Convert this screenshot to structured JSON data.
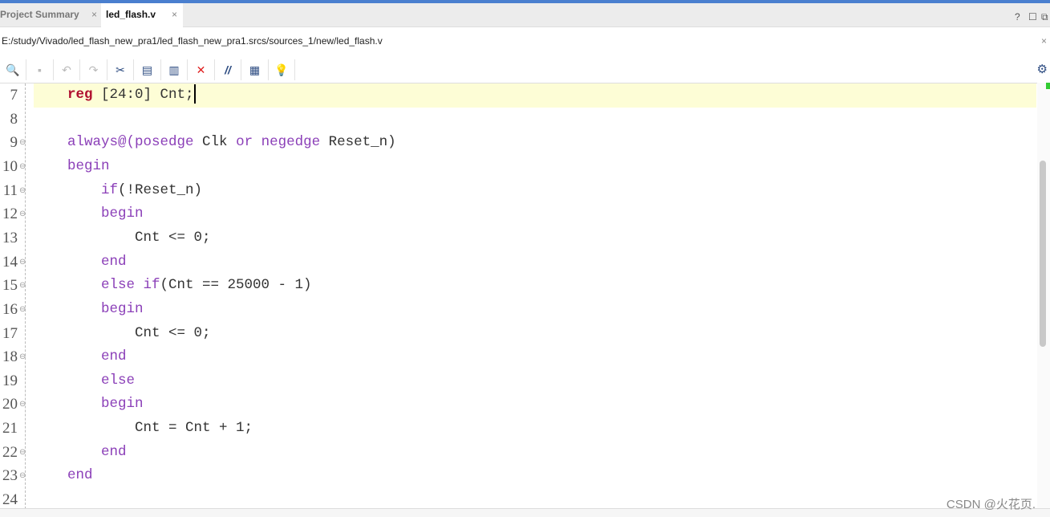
{
  "tabs": [
    {
      "label": "Project Summary",
      "close": "×"
    },
    {
      "label": "led_flash.v",
      "close": "×"
    }
  ],
  "window_controls": [
    "?",
    "☐",
    "⧉"
  ],
  "file_path": "E:/study/Vivado/led_flash_new_pra1/led_flash_new_pra1.srcs/sources_1/new/led_flash.v",
  "path_close": "×",
  "toolbar": [
    {
      "name": "search-icon",
      "glyph": "🔍"
    },
    {
      "name": "save-icon",
      "glyph": "▪"
    },
    {
      "name": "undo-icon",
      "glyph": "↶"
    },
    {
      "name": "redo-icon",
      "glyph": "↷"
    },
    {
      "name": "cut-icon",
      "glyph": "✂"
    },
    {
      "name": "copy-icon",
      "glyph": "▤"
    },
    {
      "name": "paste-icon",
      "glyph": "▥"
    },
    {
      "name": "delete-icon",
      "glyph": "✕"
    },
    {
      "name": "comment-icon",
      "glyph": "//"
    },
    {
      "name": "column-icon",
      "glyph": "▦"
    },
    {
      "name": "lightbulb-icon",
      "glyph": "💡"
    }
  ],
  "settings_icon": "⚙",
  "lines": [
    {
      "n": "7",
      "fold": false,
      "current": true,
      "tokens": [
        [
          "",
          "    "
        ],
        [
          "rg",
          "reg"
        ],
        [
          "",
          " [24:0] Cnt;"
        ]
      ]
    },
    {
      "n": "8",
      "fold": false,
      "tokens": []
    },
    {
      "n": "9",
      "fold": true,
      "tokens": [
        [
          "",
          "    "
        ],
        [
          "kw",
          "always@(posedge"
        ],
        [
          "",
          " Clk "
        ],
        [
          "kw",
          "or negedge"
        ],
        [
          "",
          " Reset_n)"
        ]
      ]
    },
    {
      "n": "10",
      "fold": true,
      "tokens": [
        [
          "",
          "    "
        ],
        [
          "kw",
          "begin"
        ]
      ]
    },
    {
      "n": "11",
      "fold": true,
      "tokens": [
        [
          "",
          "        "
        ],
        [
          "kw",
          "if"
        ],
        [
          "",
          "(!Reset_n)"
        ]
      ]
    },
    {
      "n": "12",
      "fold": true,
      "tokens": [
        [
          "",
          "        "
        ],
        [
          "kw",
          "begin"
        ]
      ]
    },
    {
      "n": "13",
      "fold": false,
      "tokens": [
        [
          "",
          "            Cnt <= 0;"
        ]
      ]
    },
    {
      "n": "14",
      "fold": true,
      "tokens": [
        [
          "",
          "        "
        ],
        [
          "kw",
          "end"
        ]
      ]
    },
    {
      "n": "15",
      "fold": true,
      "tokens": [
        [
          "",
          "        "
        ],
        [
          "kw",
          "else if"
        ],
        [
          "",
          "(Cnt == 25000 - 1)"
        ]
      ]
    },
    {
      "n": "16",
      "fold": true,
      "tokens": [
        [
          "",
          "        "
        ],
        [
          "kw",
          "begin"
        ]
      ]
    },
    {
      "n": "17",
      "fold": false,
      "tokens": [
        [
          "",
          "            Cnt <= 0;"
        ]
      ]
    },
    {
      "n": "18",
      "fold": true,
      "tokens": [
        [
          "",
          "        "
        ],
        [
          "kw",
          "end"
        ]
      ]
    },
    {
      "n": "19",
      "fold": false,
      "tokens": [
        [
          "",
          "        "
        ],
        [
          "kw",
          "else"
        ]
      ]
    },
    {
      "n": "20",
      "fold": true,
      "tokens": [
        [
          "",
          "        "
        ],
        [
          "kw",
          "begin"
        ]
      ]
    },
    {
      "n": "21",
      "fold": false,
      "tokens": [
        [
          "",
          "            Cnt = Cnt + 1;"
        ]
      ]
    },
    {
      "n": "22",
      "fold": true,
      "tokens": [
        [
          "",
          "        "
        ],
        [
          "kw",
          "end"
        ]
      ]
    },
    {
      "n": "23",
      "fold": true,
      "tokens": [
        [
          "",
          "    "
        ],
        [
          "kw",
          "end"
        ]
      ]
    },
    {
      "n": "24",
      "fold": false,
      "tokens": []
    }
  ],
  "watermark": "CSDN @火花页.",
  "colors": {
    "accent": "#4a7fcf",
    "keyword": "#8b3fb8",
    "reg_keyword": "#b01030",
    "current_line": "#fdfdd6"
  }
}
